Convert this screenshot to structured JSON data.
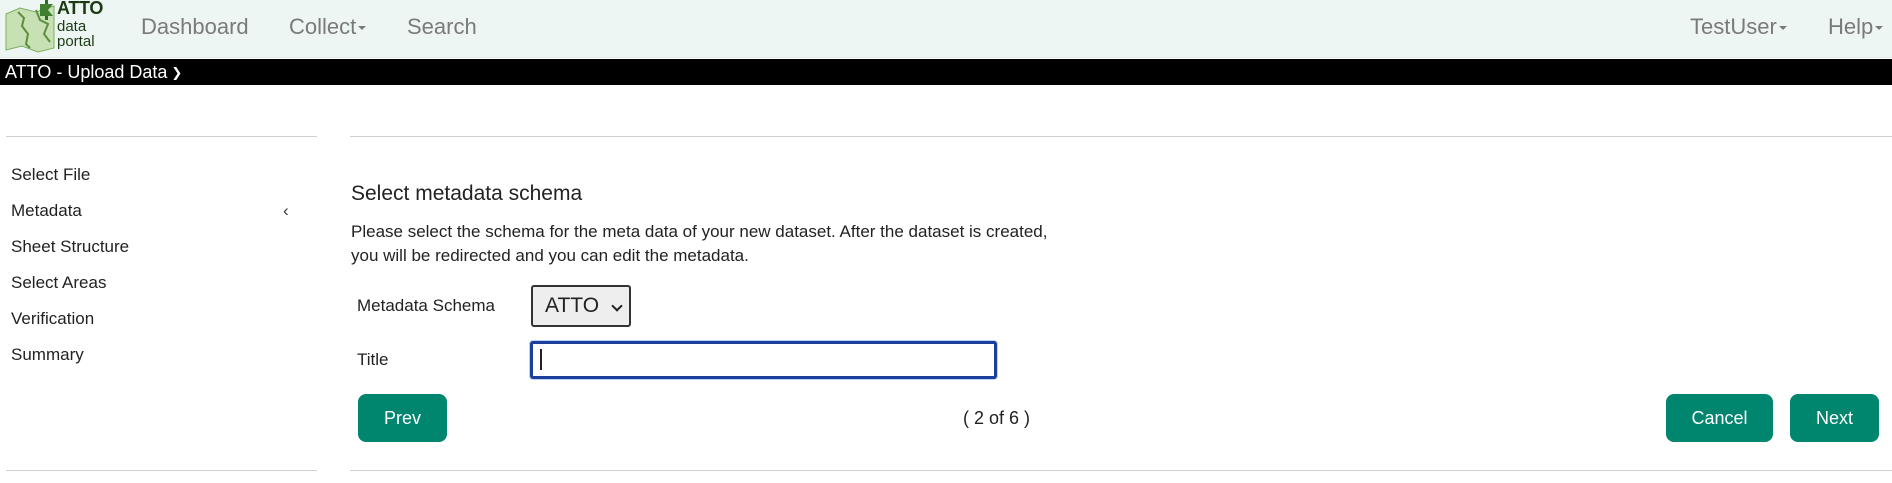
{
  "navbar": {
    "logo": {
      "title": "ATTO",
      "line1": "data",
      "line2": "portal"
    },
    "items": [
      {
        "label": "Dashboard"
      },
      {
        "label": "Collect"
      },
      {
        "label": "Search"
      }
    ],
    "user_label": "TestUser",
    "help_label": "Help"
  },
  "titlebar": {
    "label": "ATTO - Upload Data",
    "icon": "double-chevron-down-icon"
  },
  "steps": [
    {
      "label": "Select File"
    },
    {
      "label": "Metadata",
      "active": true
    },
    {
      "label": "Sheet Structure"
    },
    {
      "label": "Select Areas"
    },
    {
      "label": "Verification"
    },
    {
      "label": "Summary"
    }
  ],
  "active_step_indicator": "‹",
  "main": {
    "title": "Select metadata schema",
    "description": "Please select the schema for the meta data of your new dataset. After the dataset is created, you will be redirected and you can edit the metadata.",
    "schema_label": "Metadata Schema",
    "schema_value": "ATTO",
    "title_label": "Title",
    "title_value": ""
  },
  "footer": {
    "prev_label": "Prev",
    "progress": "( 2 of 6 )",
    "cancel_label": "Cancel",
    "next_label": "Next"
  },
  "colors": {
    "navbar_bg": "#eef6f4",
    "titlebar_bg": "#000000",
    "button_bg": "#00856f",
    "input_focus": "#1a3f9a"
  }
}
